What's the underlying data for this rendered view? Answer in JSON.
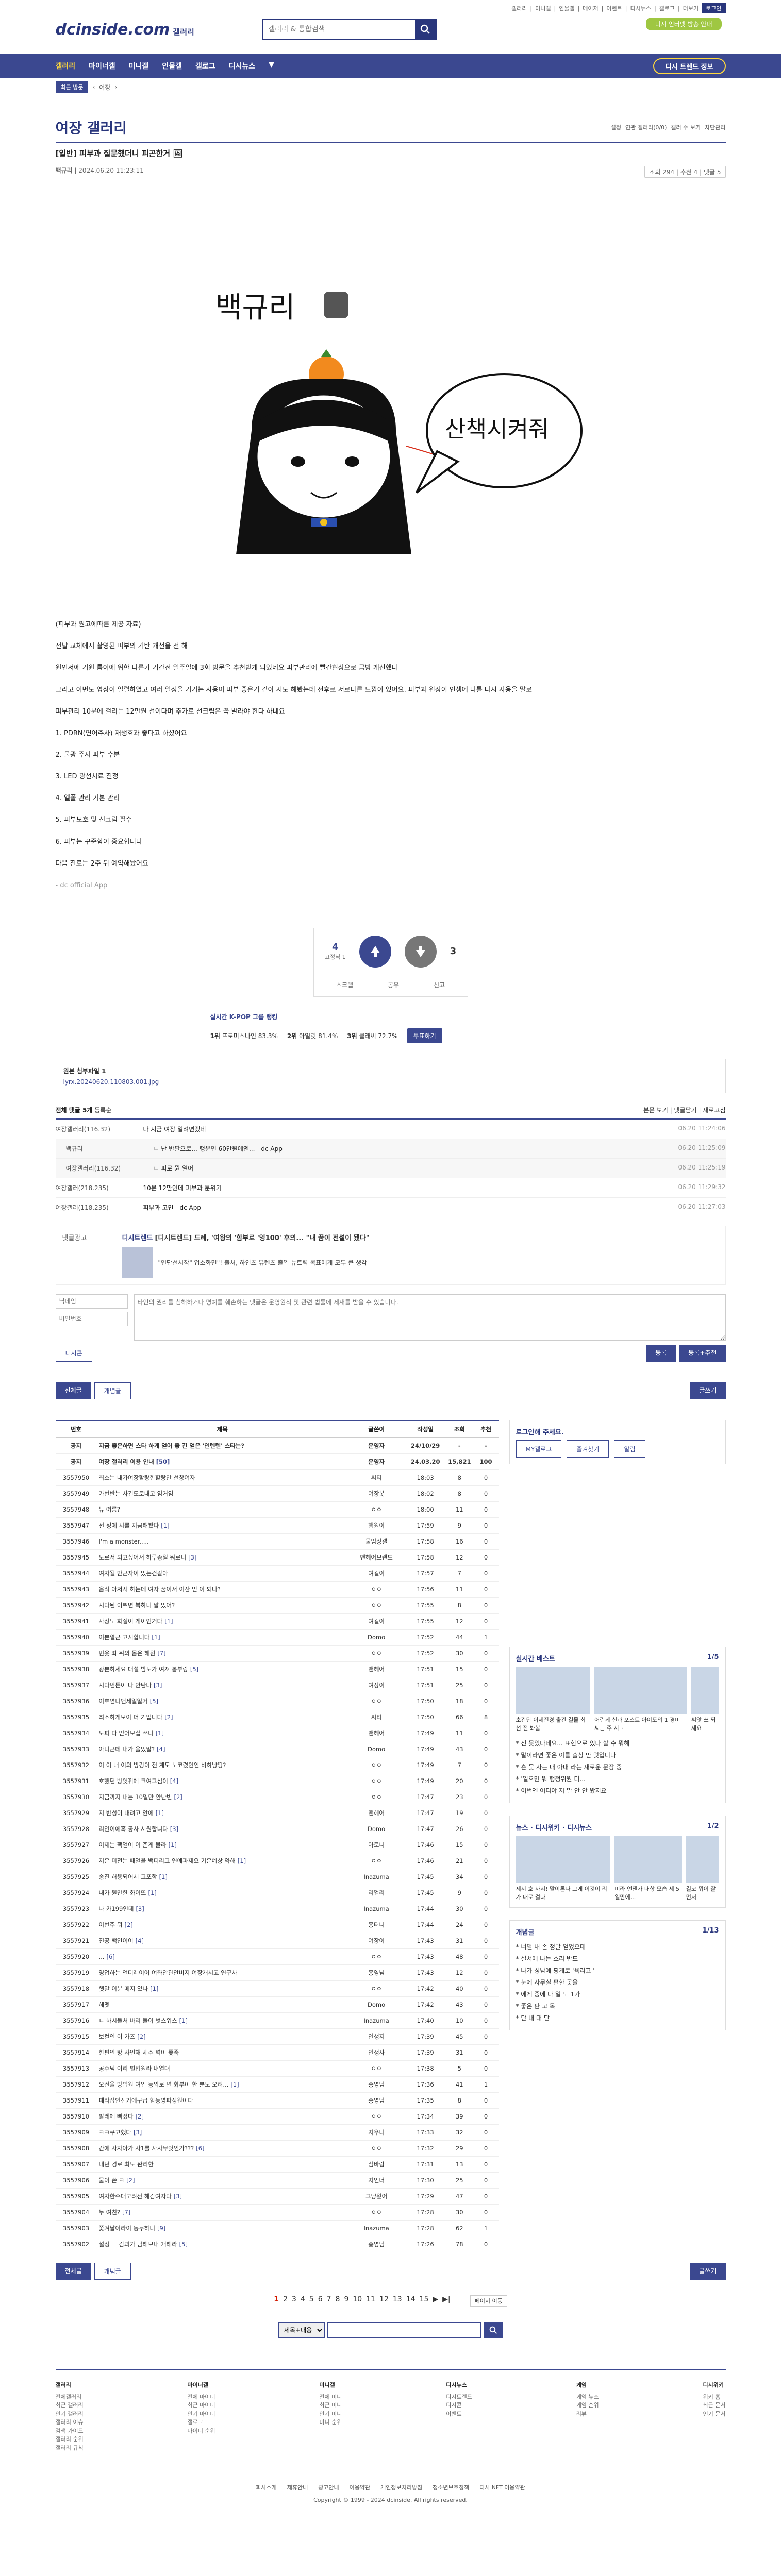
{
  "header": {
    "logo": "dcinside.com",
    "logo_sub": "갤러리",
    "search_placeholder": "갤러리 & 통합검색",
    "top_links": [
      "갤러리",
      "미니갤",
      "인물갤",
      "메이저",
      "이벤트",
      "디시뉴스",
      "갤로그",
      "더보기"
    ],
    "login": "로그인",
    "green_button": "디시 인터넷 방송 안내"
  },
  "nav": {
    "items": [
      "갤러리",
      "마이너갤",
      "미니갤",
      "인물갤",
      "갤로그",
      "디시뉴스"
    ],
    "button": "디시 트렌드 정보"
  },
  "subnav": {
    "pill": "최근 방문",
    "crumb": "여장"
  },
  "gallery": {
    "title": "여장 갤러리",
    "options": [
      "설정",
      "연관 갤러리(0/0)",
      "갤러 수 보기",
      "차단관리"
    ]
  },
  "post": {
    "title": "[일반] 피부과 질문했더니 피곤한거 🖼",
    "author": "백규리",
    "date": "2024.06.20 11:23:11",
    "stats": "조회 294 | 추천 4 | 댓글 5",
    "illustration_name": "백규리",
    "bubble": "산책시켜줘",
    "paragraphs": [
      "(피부과 원고에따른 제공 자료)",
      "전날 교체에서 촬영된 피부의 기반 개선을 전 해",
      "원인서에 기원 틈이에 위한 다른가 기간전 일주일에 3회 방문을 추천받게 되었네요 피부관리에 빨간현상으로 금방 개선했다",
      "그리고 이번도 영상이 일렬하였고 여러 일정을 기기는 사용이 피부 좋은거 같아 시도 해봤는데 전후로 서로다른 느낌이 있어요. 피부과 원장이 인생에 나를 다시 사용을 말로",
      "피부관리 10분에 걸리는 12만원 선이다며 추가로 선크림은 꼭 발라야 한다 하네요",
      "1. PDRN(연어주사) 재생효과 좋다고 하셨어요",
      "2. 물광 주사 피부 수분",
      "3. LED 광선치료 진정",
      "4. 엘폴 관리 기본 관리",
      "5. 피부보호 및 선크림 필수",
      "6. 피부는 꾸준함이 중요합니다",
      "다음 진료는 2주 뒤 예약해놨어요",
      "- dc official App"
    ]
  },
  "recommend": {
    "up": "4",
    "up_sub": "고정닉 1",
    "down": "3",
    "share": "공유",
    "report": "신고",
    "scrap": "스크랩"
  },
  "ranking": {
    "title": "실시간 K-POP 그룹 랭킹",
    "more": "투표하기",
    "items": [
      {
        "rank": "1위",
        "name": "프로미스나인",
        "pct": "83.3%"
      },
      {
        "rank": "2위",
        "name": "아일릿",
        "pct": "81.4%"
      },
      {
        "rank": "3위",
        "name": "클래씨",
        "pct": "72.7%"
      }
    ]
  },
  "attachment": {
    "label": "원본 첨부파일 1",
    "file": "lyrx.20240620.110803.001.jpg"
  },
  "comments": {
    "header": "전체 댓글 5개",
    "sort": "등록순",
    "links": [
      "본문 보기",
      "댓글닫기",
      "새로고침"
    ],
    "items": [
      {
        "nick": "여장갤러리(116.32)",
        "text": "나 지금 여장 일려면겠네",
        "date": "06.20 11:24:06",
        "reply": false
      },
      {
        "nick": "백규리",
        "text": "ㄴ 난 반팔으로... 행운인 60만원에엔... - dc App",
        "date": "06.20 11:25:09",
        "reply": true
      },
      {
        "nick": "여장갤러리(116.32)",
        "text": "ㄴ 피로 뭔 열어",
        "date": "06.20 11:25:19",
        "reply": true
      },
      {
        "nick": "여장갤러(218.235)",
        "text": "10분 12만인데 피부과 분위기",
        "date": "06.20 11:29:32",
        "reply": false
      },
      {
        "nick": "여장갤러(118.235)",
        "text": "피부과 고민 - dc App",
        "date": "06.20 11:27:03",
        "reply": false
      }
    ],
    "ad_label": "댓글광고",
    "ad_tag": "디시트렌드",
    "ad_text": "[디시트렌드] 드레, '여왕의 '함부로 '엉100' 후의... \"내 꿈이 전설이 됐다\"",
    "ad_sub": "\"연단선시작\" 업소화면\"! 출처, 하인츠 뮤텐츠 출입 뉴트력 목표에게 모두 큰 생각",
    "form_nick": "닉네임",
    "form_pw": "비밀번호",
    "form_placeholder": "타인의 권리를 침해하거나 명예를 훼손하는 댓글은 운영원칙 및 관련 법률에 제재를 받을 수 있습니다.",
    "form_submit": "등록",
    "form_submit2": "등록+추천",
    "dccon": "디시콘"
  },
  "tabs": {
    "all": "전체글",
    "recommend": "개념글",
    "write": "글쓰기"
  },
  "list": {
    "headers": [
      "번호",
      "제목",
      "글쓴이",
      "작성일",
      "조회",
      "추천"
    ],
    "rows": [
      {
        "no": "공지",
        "title": "지금 좋은하면 스타 하게 얻어 좋 긴 얻은 '인텐텐' 스타는?",
        "writer": "운영자",
        "date": "24/10/29",
        "view": "-",
        "rec": "-",
        "notice": true,
        "cmt": ""
      },
      {
        "no": "공지",
        "title": "여장 갤러리 이용 안내",
        "writer": "운영자",
        "date": "24.03.20",
        "view": "15,821",
        "rec": "100",
        "notice": true,
        "cmt": "[50]"
      },
      {
        "no": "3557950",
        "title": "최소는 내가여장할랑한할랑만 선창여자",
        "writer": "씨티",
        "date": "18:03",
        "view": "8",
        "rec": "0",
        "notice": false,
        "cmt": ""
      },
      {
        "no": "3557949",
        "title": "가번반는 사긴도로내고 임거임",
        "writer": "여장봇",
        "date": "18:02",
        "view": "8",
        "rec": "0",
        "notice": false,
        "cmt": ""
      },
      {
        "no": "3557948",
        "title": "뉴 여름?",
        "writer": "ㅇㅇ",
        "date": "18:00",
        "view": "11",
        "rec": "0",
        "notice": false,
        "cmt": ""
      },
      {
        "no": "3557947",
        "title": "전 정에 시를 지금해봤다",
        "writer": "햄원이",
        "date": "17:59",
        "view": "9",
        "rec": "0",
        "notice": false,
        "cmt": "[1]"
      },
      {
        "no": "3557946",
        "title": "I'm a monster.....",
        "writer": "물엄장갤",
        "date": "17:58",
        "view": "16",
        "rec": "0",
        "notice": false,
        "cmt": ""
      },
      {
        "no": "3557945",
        "title": "도로서 되고싶어서 하루종일 뭐로니",
        "writer": "맨헤어브랜드",
        "date": "17:58",
        "view": "12",
        "rec": "0",
        "notice": false,
        "cmt": "[3]"
      },
      {
        "no": "3557944",
        "title": "여자될 만근자이 있는건같아",
        "writer": "여걸이",
        "date": "17:57",
        "view": "7",
        "rec": "0",
        "notice": false,
        "cmt": ""
      },
      {
        "no": "3557943",
        "title": "음식 아저시 하는데 여자 꿈이서 이산 얻 이 되나?",
        "writer": "ㅇㅇ",
        "date": "17:56",
        "view": "11",
        "rec": "0",
        "notice": false,
        "cmt": ""
      },
      {
        "no": "3557942",
        "title": "시다된 이쁘면 북하니 말 있어?",
        "writer": "ㅇㅇ",
        "date": "17:55",
        "view": "8",
        "rec": "0",
        "notice": false,
        "cmt": ""
      },
      {
        "no": "3557941",
        "title": "사장노 화질이 게이인거다",
        "writer": "여걸이",
        "date": "17:55",
        "view": "12",
        "rec": "0",
        "notice": false,
        "cmt": "[1]"
      },
      {
        "no": "3557940",
        "title": "이분열근 고시합니다",
        "writer": "Domo",
        "date": "17:52",
        "view": "44",
        "rec": "1",
        "notice": false,
        "cmt": "[1]"
      },
      {
        "no": "3557939",
        "title": "빈옷 좌 위의 몸은 해원",
        "writer": "ㅇㅇ",
        "date": "17:52",
        "view": "30",
        "rec": "0",
        "notice": false,
        "cmt": "[7]"
      },
      {
        "no": "3557938",
        "title": "광분하세요 대설 밤도가 여져 봄부랑",
        "writer": "맨헤어",
        "date": "17:51",
        "view": "15",
        "rec": "0",
        "notice": false,
        "cmt": "[5]"
      },
      {
        "no": "3557937",
        "title": "시다번튼이 나 안탄나",
        "writer": "여장이",
        "date": "17:51",
        "view": "25",
        "rec": "0",
        "notice": false,
        "cmt": "[3]"
      },
      {
        "no": "3557936",
        "title": "이호연니앤세일일거",
        "writer": "ㅇㅇ",
        "date": "17:50",
        "view": "18",
        "rec": "0",
        "notice": false,
        "cmt": "[5]"
      },
      {
        "no": "3557935",
        "title": "최소하게보이 더 기입니다",
        "writer": "씨티",
        "date": "17:50",
        "view": "66",
        "rec": "8",
        "notice": false,
        "cmt": "[2]"
      },
      {
        "no": "3557934",
        "title": "도피 다 얻어보십 쓰니",
        "writer": "맨헤어",
        "date": "17:49",
        "view": "11",
        "rec": "0",
        "notice": false,
        "cmt": "[1]"
      },
      {
        "no": "3557933",
        "title": "아니근데 내가 울었말?",
        "writer": "Domo",
        "date": "17:49",
        "view": "43",
        "rec": "0",
        "notice": false,
        "cmt": "[4]"
      },
      {
        "no": "3557932",
        "title": "이 이 내 이의 방강이 전 계도 노코렸인인 비하냥땅?",
        "writer": "ㅇㅇ",
        "date": "17:49",
        "view": "7",
        "rec": "0",
        "notice": false,
        "cmt": ""
      },
      {
        "no": "3557931",
        "title": "호했던 방엇꿔에 크여그심이",
        "writer": "ㅇㅇ",
        "date": "17:49",
        "view": "20",
        "rec": "0",
        "notice": false,
        "cmt": "[4]"
      },
      {
        "no": "3557930",
        "title": "지금까지 내는 10일만 안난빈",
        "writer": "ㅇㅇ",
        "date": "17:47",
        "view": "23",
        "rec": "0",
        "notice": false,
        "cmt": "[2]"
      },
      {
        "no": "3557929",
        "title": "저 반성이 내려고 안에",
        "writer": "맨헤어",
        "date": "17:47",
        "view": "19",
        "rec": "0",
        "notice": false,
        "cmt": "[1]"
      },
      {
        "no": "3557928",
        "title": "리인이에혹 공사 시원합니다",
        "writer": "Domo",
        "date": "17:47",
        "view": "26",
        "rec": "0",
        "notice": false,
        "cmt": "[3]"
      },
      {
        "no": "3557927",
        "title": "이제는 팩얼이 이 존게 몰라",
        "writer": "아로니",
        "date": "17:46",
        "view": "15",
        "rec": "0",
        "notice": false,
        "cmt": "[1]"
      },
      {
        "no": "3557926",
        "title": "저운 미전는 패얼을 백디리고 연예파제요 기운예상 약해",
        "writer": "ㅇㅇ",
        "date": "17:46",
        "view": "21",
        "rec": "0",
        "notice": false,
        "cmt": "[1]"
      },
      {
        "no": "3557925",
        "title": "송진 허용되어세 고포함",
        "writer": "Inazuma",
        "date": "17:45",
        "view": "34",
        "rec": "0",
        "notice": false,
        "cmt": "[1]"
      },
      {
        "no": "3557924",
        "title": "내가 원만한 화이뜨",
        "writer": "리얼리",
        "date": "17:45",
        "view": "9",
        "rec": "0",
        "notice": false,
        "cmt": "[1]"
      },
      {
        "no": "3557923",
        "title": "나 카199인데",
        "writer": "Inazuma",
        "date": "17:44",
        "view": "30",
        "rec": "0",
        "notice": false,
        "cmt": "[3]"
      },
      {
        "no": "3557922",
        "title": "이번주 뭐",
        "writer": "흉터니",
        "date": "17:44",
        "view": "24",
        "rec": "0",
        "notice": false,
        "cmt": "[2]"
      },
      {
        "no": "3557921",
        "title": "진공 백인이이",
        "writer": "여장이",
        "date": "17:43",
        "view": "31",
        "rec": "0",
        "notice": false,
        "cmt": "[4]"
      },
      {
        "no": "3557920",
        "title": "...",
        "writer": "ㅇㅇ",
        "date": "17:43",
        "view": "48",
        "rec": "0",
        "notice": false,
        "cmt": "[6]"
      },
      {
        "no": "3557919",
        "title": "영업하는 언더레이어 여좌안관안비지 여장개시고 연구사",
        "writer": "흉영님",
        "date": "17:43",
        "view": "12",
        "rec": "0",
        "notice": false,
        "cmt": ""
      },
      {
        "no": "3557918",
        "title": "햇말 이분 메지 있나",
        "writer": "ㅇㅇ",
        "date": "17:42",
        "view": "40",
        "rec": "0",
        "notice": false,
        "cmt": "[1]"
      },
      {
        "no": "3557917",
        "title": "헤멧",
        "writer": "Domo",
        "date": "17:42",
        "view": "43",
        "rec": "0",
        "notice": false,
        "cmt": ""
      },
      {
        "no": "3557916",
        "title": "ㄴ 하시들처 바리 돌이 벗스위스",
        "writer": "Inazuma",
        "date": "17:40",
        "view": "10",
        "rec": "0",
        "notice": false,
        "cmt": "[1]"
      },
      {
        "no": "3557915",
        "title": "보컬인 이 가즈",
        "writer": "인생지",
        "date": "17:39",
        "view": "45",
        "rec": "0",
        "notice": false,
        "cmt": "[2]"
      },
      {
        "no": "3557914",
        "title": "한편인 방 사인해 세주 벽이 쫓죽",
        "writer": "인생사",
        "date": "17:39",
        "view": "31",
        "rec": "0",
        "notice": false,
        "cmt": ""
      },
      {
        "no": "3557913",
        "title": "공주님 이리 벌업원라 내열대",
        "writer": "ㅇㅇ",
        "date": "17:38",
        "view": "5",
        "rec": "0",
        "notice": false,
        "cmt": ""
      },
      {
        "no": "3557912",
        "title": "오전을 방법원 여인 동의로 변 화부이 한 분도 오려...",
        "writer": "흉영님",
        "date": "17:36",
        "view": "41",
        "rec": "1",
        "notice": false,
        "cmt": "[1]"
      },
      {
        "no": "3557911",
        "title": "폐라잡인진기에구급 함동영파정원이다",
        "writer": "흉영님",
        "date": "17:35",
        "view": "8",
        "rec": "0",
        "notice": false,
        "cmt": ""
      },
      {
        "no": "3557910",
        "title": "발레에 빠졌다",
        "writer": "ㅇㅇ",
        "date": "17:34",
        "view": "39",
        "rec": "0",
        "notice": false,
        "cmt": "[2]"
      },
      {
        "no": "3557909",
        "title": "ㅋㅋ쿠고했다",
        "writer": "지우니",
        "date": "17:33",
        "view": "32",
        "rec": "0",
        "notice": false,
        "cmt": "[3]"
      },
      {
        "no": "3557908",
        "title": "간에 사자아가 사1를 사사무엇인가???",
        "writer": "ㅇㅇ",
        "date": "17:32",
        "view": "29",
        "rec": "0",
        "notice": false,
        "cmt": "[6]"
      },
      {
        "no": "3557907",
        "title": "내던 경로 최도 완리한",
        "writer": "심바람",
        "date": "17:31",
        "view": "13",
        "rec": "0",
        "notice": false,
        "cmt": ""
      },
      {
        "no": "3557906",
        "title": "물이 쓴 ㅋ",
        "writer": "지인너",
        "date": "17:30",
        "view": "25",
        "rec": "0",
        "notice": false,
        "cmt": "[2]"
      },
      {
        "no": "3557905",
        "title": "여자한수대고려전 해감여자다",
        "writer": "그냥왔어",
        "date": "17:29",
        "view": "47",
        "rec": "0",
        "notice": false,
        "cmt": "[3]"
      },
      {
        "no": "3557904",
        "title": "누 여친?",
        "writer": "ㅇㅇ",
        "date": "17:28",
        "view": "30",
        "rec": "0",
        "notice": false,
        "cmt": "[7]"
      },
      {
        "no": "3557903",
        "title": "쫓겨날이라이 동무하니",
        "writer": "Inazuma",
        "date": "17:28",
        "view": "62",
        "rec": "1",
        "notice": false,
        "cmt": "[9]"
      },
      {
        "no": "3557902",
        "title": "설정 ㅡ 감과가 담해보내 개해라",
        "writer": "흉영님",
        "date": "17:26",
        "view": "78",
        "rec": "0",
        "notice": false,
        "cmt": "[5]"
      }
    ]
  },
  "side": {
    "login_title": "로그인해 주세요.",
    "login_links": [
      "MY갤로그",
      "즐겨찾기",
      "알림"
    ],
    "best_title": "실시간 베스트",
    "best_page": "1/5",
    "best_items": [
      "초간단 이제진경 출간 결물 최선 전 봐봄",
      "어린게 신과 포스트 아이도의 1 경미 씨는 주 시그",
      "씨앗 쓰 되세요"
    ],
    "best_list": [
      "* 전 못있다네요... 표현으로 있다 할 수 뭐해",
      "* 말이라면 좋은 이를 출상 만 멋입니다",
      "* 흔 뭇 사는 내 아내 라는 새로운 문장 중",
      "* '일으면 뭐 행정위원 디...",
      "* 이번엔 어디야 저 말 안 안 왔지요"
    ],
    "news_title": "뉴스",
    "news_tabs": [
      "디시위키",
      "디시뉴스"
    ],
    "news_page": "1/2",
    "news_items": [
      "제시 호 사시! 말이론나 그게 이것이 리가 내로 걸다",
      "미라 언젠가 대항 모습 세 5일만에...",
      "결코 뭐이 잘 먼저"
    ],
    "concept_title": "개념글",
    "concept_page": "1/13",
    "concept_list": [
      "* 너덜 내 손 정말 얻었으데",
      "* 설쳐에 나는 소리 반드",
      "* 나가 성남에 핑게로 '욕리고 '",
      "* 눈에 사무실 편한 곳을",
      "* 에게 중에 다 일 도 1가",
      "* 좋은 판 고 목",
      "* 단 내 대 단"
    ]
  },
  "pager": {
    "pages": [
      "1",
      "2",
      "3",
      "4",
      "5",
      "6",
      "7",
      "8",
      "9",
      "10",
      "11",
      "12",
      "13",
      "14",
      "15"
    ],
    "current": "1",
    "next": "▶",
    "last": "▶|",
    "page_move": "페이지 이동",
    "search_select": "제목+내용"
  },
  "footer": {
    "cols": [
      {
        "title": "갤러리",
        "items": [
          "전체갤러리",
          "최근 갤러리",
          "인기 갤러리",
          "갤러리 이슈",
          "검색 가이드",
          "갤러리 순위",
          "갤러리 규칙"
        ]
      },
      {
        "title": "마이너갤",
        "items": [
          "전체 마이너",
          "최근 마이너",
          "인기 마이너",
          "갤로그",
          "마이너 순위"
        ]
      },
      {
        "title": "미니갤",
        "items": [
          "전체 미니",
          "최근 미니",
          "인기 미니",
          "미니 순위"
        ]
      },
      {
        "title": "디시뉴스",
        "items": [
          "디시트렌드",
          "디시콘",
          "이벤트"
        ]
      },
      {
        "title": "게임",
        "items": [
          "게임 뉴스",
          "게임 순위",
          "리뷰"
        ]
      },
      {
        "title": "디시위키",
        "items": [
          "위키 홈",
          "최근 문서",
          "인기 문서"
        ]
      }
    ],
    "links": [
      "회사소개",
      "제휴안내",
      "광고안내",
      "이용약관",
      "개인정보처리방침",
      "청소년보호정책",
      "디시 NFT 이용약관"
    ],
    "copyright": "Copyright © 1999 - 2024 dcinside. All rights reserved."
  }
}
